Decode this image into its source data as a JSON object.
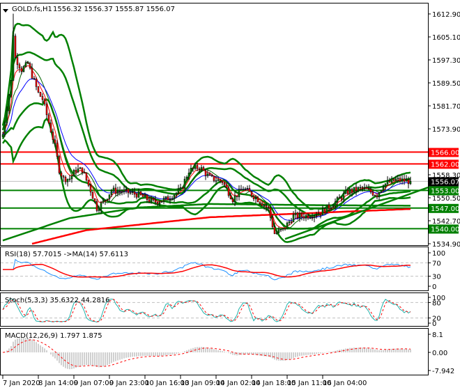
{
  "header": {
    "symbol": "GOLD.fs,H1",
    "ohlc": "1556.32 1556.37 1555.87 1556.07"
  },
  "indicators": {
    "rsi": "RSI(18) 57.7015  ->MA(14) 57.6113",
    "stoch": "Stoch(5,3,3) 35.6322 44.2816",
    "macd": "MACD(12,26,9) 1.797 1.875"
  },
  "colors": {
    "up": "#008000",
    "down": "#ff0000",
    "band": "#008000",
    "fast_ma": "#ff0000",
    "slow_ma": "#0000ff",
    "rsi": "#1e90ff",
    "stoch": "#20b2aa",
    "grid": "#c0c0c0"
  },
  "chart_data": [
    {
      "type": "line",
      "title": "GOLD.fs,H1",
      "ylim": [
        1534.9,
        1612.9
      ],
      "y_ticks": [
        "1612.90",
        "1605.10",
        "1597.30",
        "1589.50",
        "1581.70",
        "1573.90",
        "1558.30",
        "1550.50",
        "1542.70",
        "1534.90"
      ],
      "y_tick_values": [
        1612.9,
        1605.1,
        1597.3,
        1589.5,
        1581.7,
        1573.9,
        1558.3,
        1550.5,
        1542.7,
        1534.9
      ],
      "x_ticks": [
        "7 Jan 2020",
        "8 Jan 14:00",
        "9 Jan 07:00",
        "9 Jan 23:00",
        "10 Jan 16:00",
        "13 Jan 09:00",
        "14 Jan 02:00",
        "14 Jan 18:00",
        "15 Jan 11:00",
        "16 Jan 04:00"
      ],
      "x_tick_bars": [
        0,
        17,
        34,
        51,
        68,
        85,
        102,
        119,
        136,
        153
      ],
      "bar_count": 196,
      "close_keypoints": [
        [
          0,
          1572
        ],
        [
          4,
          1590
        ],
        [
          5,
          1606
        ],
        [
          6,
          1598
        ],
        [
          9,
          1594
        ],
        [
          12,
          1596
        ],
        [
          15,
          1590
        ],
        [
          17,
          1586
        ],
        [
          19,
          1584
        ],
        [
          22,
          1576
        ],
        [
          25,
          1568
        ],
        [
          27,
          1560
        ],
        [
          29,
          1557
        ],
        [
          32,
          1557
        ],
        [
          35,
          1560
        ],
        [
          38,
          1560
        ],
        [
          42,
          1553
        ],
        [
          45,
          1547
        ],
        [
          48,
          1549
        ],
        [
          52,
          1553
        ],
        [
          58,
          1552.6
        ],
        [
          65,
          1551.5
        ],
        [
          72,
          1549
        ],
        [
          78,
          1550
        ],
        [
          85,
          1553
        ],
        [
          89,
          1559.7
        ],
        [
          94,
          1561
        ],
        [
          99,
          1557.3
        ],
        [
          105,
          1556
        ],
        [
          110,
          1550
        ],
        [
          115,
          1553.8
        ],
        [
          122,
          1550
        ],
        [
          127,
          1546.7
        ],
        [
          130,
          1538.4
        ],
        [
          134,
          1539.6
        ],
        [
          139,
          1544.3
        ],
        [
          145,
          1544.3
        ],
        [
          152,
          1545.5
        ],
        [
          159,
          1549
        ],
        [
          165,
          1552.6
        ],
        [
          172,
          1553.8
        ],
        [
          179,
          1551.5
        ],
        [
          182,
          1555
        ],
        [
          188,
          1556.6
        ],
        [
          195,
          1556.07
        ]
      ],
      "long_ma_keypoints": [
        [
          14,
          1534.9
        ],
        [
          40,
          1539.5
        ],
        [
          99,
          1543.9
        ],
        [
          195,
          1546.7
        ]
      ],
      "slow_line_keypoints": [
        [
          0,
          1536
        ],
        [
          32,
          1543.6
        ],
        [
          65,
          1547.2
        ],
        [
          99,
          1548.4
        ],
        [
          150,
          1548
        ],
        [
          195,
          1547.8
        ]
      ],
      "trendline": [
        [
          135,
          1536.5
        ],
        [
          203,
          1554
        ]
      ],
      "levels": [
        {
          "label": "1566.00",
          "value": 1566.0,
          "color": "#ff0000"
        },
        {
          "label": "1562.00",
          "value": 1562.0,
          "color": "#ff0000"
        },
        {
          "label": "1553.00",
          "value": 1553.0,
          "color": "#008000"
        },
        {
          "label": "1547.00",
          "value": 1547.0,
          "color": "#008000"
        },
        {
          "label": "1540.00",
          "value": 1540.0,
          "color": "#008000"
        }
      ],
      "current_price": {
        "label": "1556.07",
        "value": 1556.07
      }
    },
    {
      "type": "line",
      "title": "RSI(18)",
      "ylim": [
        0,
        100
      ],
      "y_ticks": [
        "100",
        "70",
        "30",
        "0"
      ],
      "y_tick_values": [
        100,
        70,
        30,
        0
      ],
      "period": 18,
      "ma_period": 14
    },
    {
      "type": "line",
      "title": "Stoch(5,3,3)",
      "ylim": [
        0,
        100
      ],
      "y_ticks": [
        "100",
        "80",
        "20",
        "0"
      ],
      "y_tick_values": [
        100,
        80,
        20,
        0
      ]
    },
    {
      "type": "bar",
      "title": "MACD(12,26,9)",
      "ylim": [
        -7.942,
        8.1
      ],
      "y_ticks": [
        "8.1",
        "0.00",
        "-7.942"
      ],
      "y_tick_values": [
        8.1,
        0,
        -7.942
      ]
    }
  ]
}
